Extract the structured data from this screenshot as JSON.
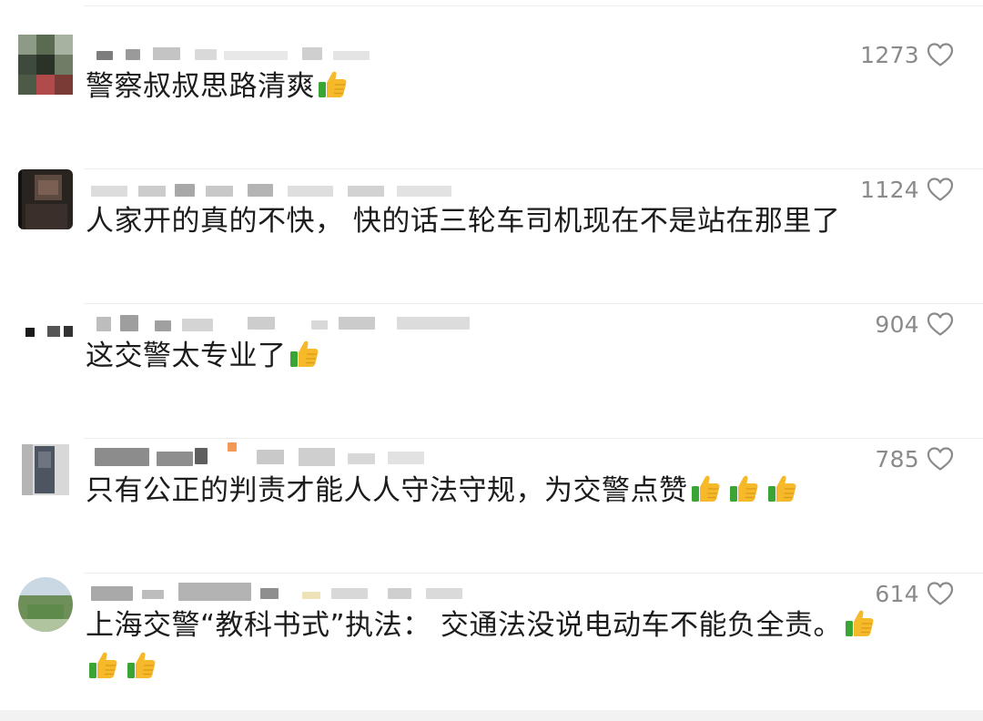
{
  "comments": [
    {
      "likes": "1273",
      "text": "警察叔叔思路清爽",
      "emoji_count": 1,
      "avatar_colors": [
        "#7a8a78",
        "#3d4a3c",
        "#b14a4a",
        "#5a6b52",
        "#2b3328",
        "#9fa89a"
      ]
    },
    {
      "likes": "1124",
      "text": "人家开的真的不快， 快的话三轮车司机现在不是站在那里了",
      "emoji_count": 0,
      "avatar_colors": [
        "#4b3a33",
        "#2a2421",
        "#7a5f52",
        "#1b1715",
        "#5c4a40",
        "#3a2f2a"
      ]
    },
    {
      "likes": "904",
      "text": "这交警太专业了",
      "emoji_count": 1,
      "avatar_colors": []
    },
    {
      "likes": "785",
      "text": "只有公正的判责才能人人守法守规，为交警点赞",
      "emoji_count": 3,
      "avatar_colors": [
        "#c9c9c9",
        "#8f8f8f",
        "#4d5561",
        "#d8d8d8",
        "#6e7480",
        "#b5b5b5"
      ]
    },
    {
      "likes": "614",
      "text": "上海交警“教科书式”执法： 交通法没说电动车不能负全责。",
      "text_line2": "",
      "emoji_count": 1,
      "emoji_count_line2": 2,
      "avatar_colors": [
        "#9fb8c8",
        "#7ea16a",
        "#5e8a4c",
        "#c9d8e2",
        "#6f8f5a",
        "#b0c4a0"
      ]
    }
  ],
  "icons": {
    "like": "heart-outline-icon",
    "emoji": "thumbs-up-emoji"
  },
  "colors": {
    "text": "#1c1c1c",
    "likes": "#8a8a8a",
    "thumb_yellow": "#f5b92a",
    "thumb_green": "#3aa535"
  }
}
